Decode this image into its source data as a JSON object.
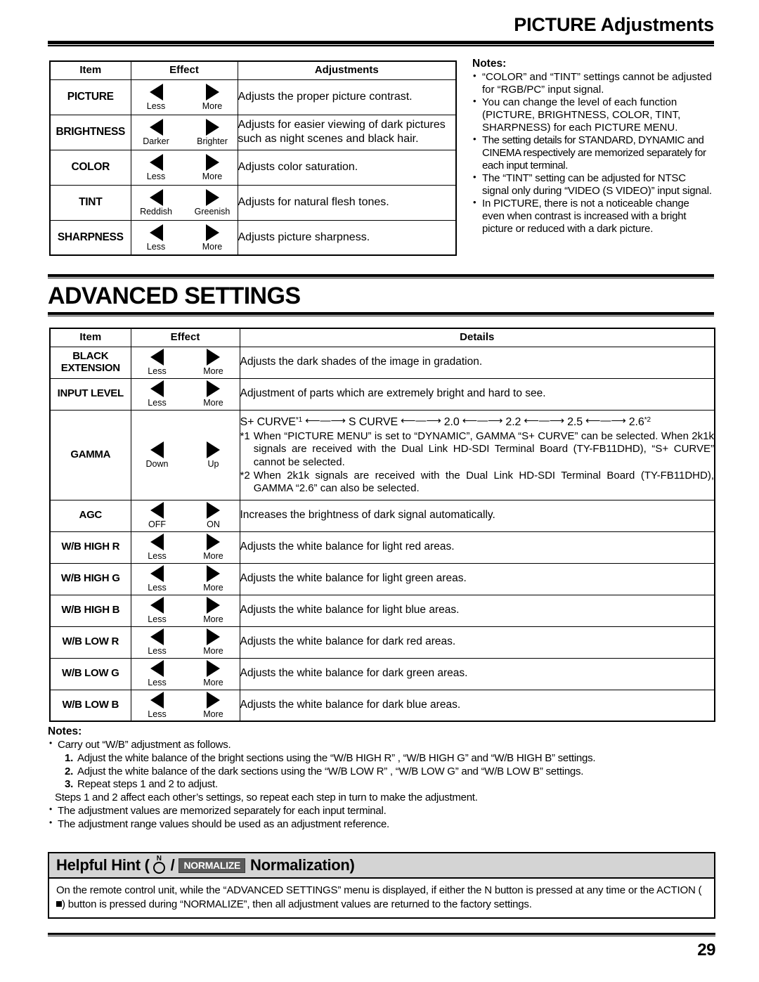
{
  "header": {
    "title": "PICTURE Adjustments"
  },
  "picture_table": {
    "columns": [
      "Item",
      "Effect",
      "Adjustments"
    ],
    "rows": [
      {
        "item": "PICTURE",
        "left_label": "Less",
        "right_label": "More",
        "detail": "Adjusts the proper picture contrast."
      },
      {
        "item": "BRIGHTNESS",
        "left_label": "Darker",
        "right_label": "Brighter",
        "detail": "Adjusts for easier viewing of dark pictures such as night scenes and black hair."
      },
      {
        "item": "COLOR",
        "left_label": "Less",
        "right_label": "More",
        "detail": "Adjusts color saturation."
      },
      {
        "item": "TINT",
        "left_label": "Reddish",
        "right_label": "Greenish",
        "detail": "Adjusts for natural flesh tones."
      },
      {
        "item": "SHARPNESS",
        "left_label": "Less",
        "right_label": "More",
        "detail": "Adjusts picture sharpness."
      }
    ]
  },
  "picture_notes": {
    "title": "Notes:",
    "items": [
      "“COLOR” and “TINT” settings cannot be adjusted for “RGB/PC” input signal.",
      "You can change the level of each function (PICTURE, BRIGHTNESS, COLOR, TINT, SHARPNESS) for each PICTURE MENU.",
      "The setting details for STANDARD, DYNAMIC and CINEMA respectively are memorized separately for each input terminal.",
      "The “TINT” setting can be adjusted for NTSC signal only during “VIDEO (S VIDEO)” input signal.",
      "In PICTURE, there is not a noticeable change even when contrast is increased with a bright picture or reduced with a dark picture."
    ]
  },
  "advanced": {
    "section_title": "ADVANCED SETTINGS",
    "columns": [
      "Item",
      "Effect",
      "Details"
    ],
    "rows": [
      {
        "item": "BLACK EXTENSION",
        "left_label": "Less",
        "right_label": "More",
        "detail": "Adjusts the dark shades of the image in gradation."
      },
      {
        "item": "INPUT LEVEL",
        "left_label": "Less",
        "right_label": "More",
        "detail": "Adjustment of parts which are extremely bright and hard to see."
      },
      {
        "item": "GAMMA",
        "left_label": "Down",
        "right_label": "Up",
        "detail": ""
      },
      {
        "item": "AGC",
        "left_label": "OFF",
        "right_label": "ON",
        "detail": "Increases the brightness of dark signal automatically."
      },
      {
        "item": "W/B HIGH R",
        "left_label": "Less",
        "right_label": "More",
        "detail": "Adjusts the white balance for light red areas."
      },
      {
        "item": "W/B HIGH G",
        "left_label": "Less",
        "right_label": "More",
        "detail": "Adjusts the white balance for light green areas."
      },
      {
        "item": "W/B HIGH B",
        "left_label": "Less",
        "right_label": "More",
        "detail": "Adjusts the white balance for light blue areas."
      },
      {
        "item": "W/B LOW R",
        "left_label": "Less",
        "right_label": "More",
        "detail": "Adjusts the white balance for dark red areas."
      },
      {
        "item": "W/B LOW G",
        "left_label": "Less",
        "right_label": "More",
        "detail": "Adjusts the white balance for dark green areas."
      },
      {
        "item": "W/B LOW B",
        "left_label": "Less",
        "right_label": "More",
        "detail": "Adjusts the white balance for dark blue areas."
      }
    ]
  },
  "gamma_detail": {
    "chain": [
      "S+ CURVE",
      "S CURVE",
      "2.0",
      "2.2",
      "2.5",
      "2.6"
    ],
    "chain_sup_first": "*1",
    "chain_sup_last": "*2",
    "footnote1_mark": "*1",
    "footnote1_text": "When “PICTURE MENU” is set to “DYNAMIC”, GAMMA “S+ CURVE” can be selected. When 2k1k signals are received with the Dual Link HD-SDI Terminal Board (TY-FB11DHD), “S+ CURVE” cannot be selected.",
    "footnote2_mark": "*2",
    "footnote2_text": "When 2k1k signals are received with the Dual Link HD-SDI Terminal Board (TY-FB11DHD), GAMMA “2.6” can also be selected."
  },
  "advanced_notes": {
    "title": "Notes:",
    "lead": "Carry out “W/B” adjustment as follows.",
    "steps": [
      {
        "num": "1.",
        "text": "Adjust the white balance of the bright sections using the “W/B HIGH R” , “W/B HIGH G” and “W/B HIGH B” settings."
      },
      {
        "num": "2.",
        "text": "Adjust the white balance of the dark sections using the “W/B LOW R” , “W/B LOW G” and “W/B LOW B” settings."
      },
      {
        "num": "3.",
        "text": "Repeat steps 1 and 2 to adjust."
      }
    ],
    "steps_note": "Steps 1 and 2 affect each other’s settings, so repeat each step in turn to make the adjustment.",
    "items": [
      "The adjustment values are memorized separately for each input terminal.",
      "The adjustment range values should be used as an adjustment reference."
    ]
  },
  "hint": {
    "title_prefix": "Helpful Hint (",
    "n_label": "N",
    "slash": "/",
    "normalize_badge": "NORMALIZE",
    "title_suffix": "Normalization)",
    "body_line1": "On the remote control unit, while the “ADVANCED SETTINGS” menu is displayed, if either the N button is pressed at any time",
    "body_line2_a": "or the ACTION (",
    "body_line2_b": ") button is pressed during “NORMALIZE”, then all adjustment values are returned to the factory settings."
  },
  "footer": {
    "page_number": "29"
  }
}
